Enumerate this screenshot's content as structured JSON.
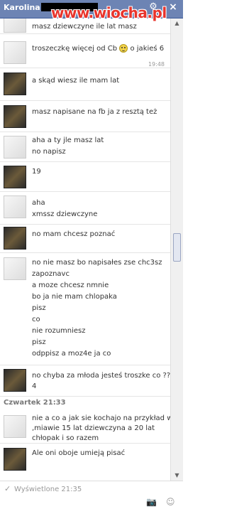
{
  "header": {
    "name": "Karolina",
    "gear_icon": "gear-icon",
    "close_icon": "close-icon",
    "watermark": "www.wiocha.pl"
  },
  "messages": [
    {
      "lines": [
        "masz dziewczyne ile lat masz"
      ]
    },
    {
      "lines": [
        "troszeczkę więcej od Cb",
        "o jakieś 6"
      ],
      "stamp": "19:48"
    },
    {
      "lines": [
        "a skąd wiesz ile mam lat"
      ]
    },
    {
      "lines": [
        "masz napisane na fb ja z resztą też"
      ]
    },
    {
      "lines": [
        "aha a ty jle masz lat",
        "no napisz"
      ]
    },
    {
      "lines": [
        "19"
      ]
    },
    {
      "lines": [
        "aha",
        "xmssz dziewczyne"
      ]
    },
    {
      "lines": [
        "no mam chcesz poznać"
      ]
    },
    {
      "lines": [
        "no nie masz bo napisałes zse chc3sz",
        "zapoznavc",
        "a moze chcesz nmnie",
        "bo ja nie mam chlopaka",
        "pisz",
        "co",
        "nie rozumniesz",
        "pisz",
        "odppisz a moz4e ja co"
      ]
    },
    {
      "lines": [
        "no chyba za młoda jesteś troszke co ??",
        "4"
      ]
    },
    {
      "lines": [
        "nie a co a jak sie kochajo na przykład w",
        ",miawie 15 lat dziewczyna a 20 lat",
        "chłopak i  so razem"
      ]
    },
    {
      "lines": [
        "Ale oni oboje umieją pisać"
      ]
    }
  ],
  "day_label": "Czwartek 21:33",
  "footer": {
    "seen": "Wyświetlone 21:35",
    "check_icon": "checkmark-icon",
    "camera_icon": "camera-icon",
    "emoticon_icon": "emoticon-icon"
  }
}
